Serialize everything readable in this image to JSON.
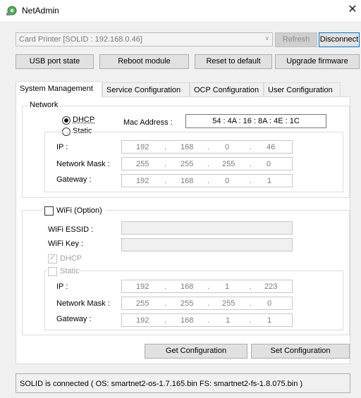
{
  "window": {
    "title": "NetAdmin"
  },
  "device_combo": {
    "value": "Card Printer  [SOLID : 192.168.0.46]"
  },
  "buttons": {
    "refresh": "Refresh",
    "disconnect": "Disconnect",
    "usb_port_state": "USB port state",
    "reboot_module": "Reboot module",
    "reset_default": "Reset to default",
    "upgrade_firmware": "Upgrade firmware",
    "get_config": "Get Configuration",
    "set_config": "Set Configuration"
  },
  "tabs": [
    {
      "label": "System Management",
      "active": true
    },
    {
      "label": "Service Configuration"
    },
    {
      "label": "OCP Configuration"
    },
    {
      "label": "User Configuration"
    }
  ],
  "network": {
    "group_label": "Network",
    "dhcp_label": "DHCP",
    "static_label": "Static",
    "mode": "DHCP",
    "mac_label": "Mac Address :",
    "mac_value": "54 : 4A : 16 : 8A : 4E : 1C",
    "ip_label": "IP :",
    "mask_label": "Network Mask :",
    "gateway_label": "Gateway :",
    "ip": [
      "192",
      "168",
      "0",
      "46"
    ],
    "mask": [
      "255",
      "255",
      "255",
      "0"
    ],
    "gateway": [
      "192",
      "168",
      "0",
      "1"
    ]
  },
  "wifi": {
    "option_label": "WiFi (Option)",
    "enabled": false,
    "essid_label": "WiFi ESSID :",
    "key_label": "WiFi Key :",
    "essid": "",
    "key": "",
    "dhcp_label": "DHCP",
    "dhcp_checked": true,
    "static_label": "Static",
    "static_checked": false,
    "ip_label": "IP :",
    "mask_label": "Network Mask :",
    "gateway_label": "Gateway :",
    "ip": [
      "192",
      "168",
      "1",
      "223"
    ],
    "mask": [
      "255",
      "255",
      "255",
      "0"
    ],
    "gateway": [
      "192",
      "168",
      "1",
      "1"
    ]
  },
  "ip_separator": ".",
  "status": {
    "text": "SOLID is connected ( OS: smartnet2-os-1.7.165.bin  FS: smartnet2-fs-1.8.075.bin )"
  },
  "icons": {
    "app": "network-admin-icon",
    "close": "close-icon",
    "combo_arrow": "chevron-down-icon"
  }
}
